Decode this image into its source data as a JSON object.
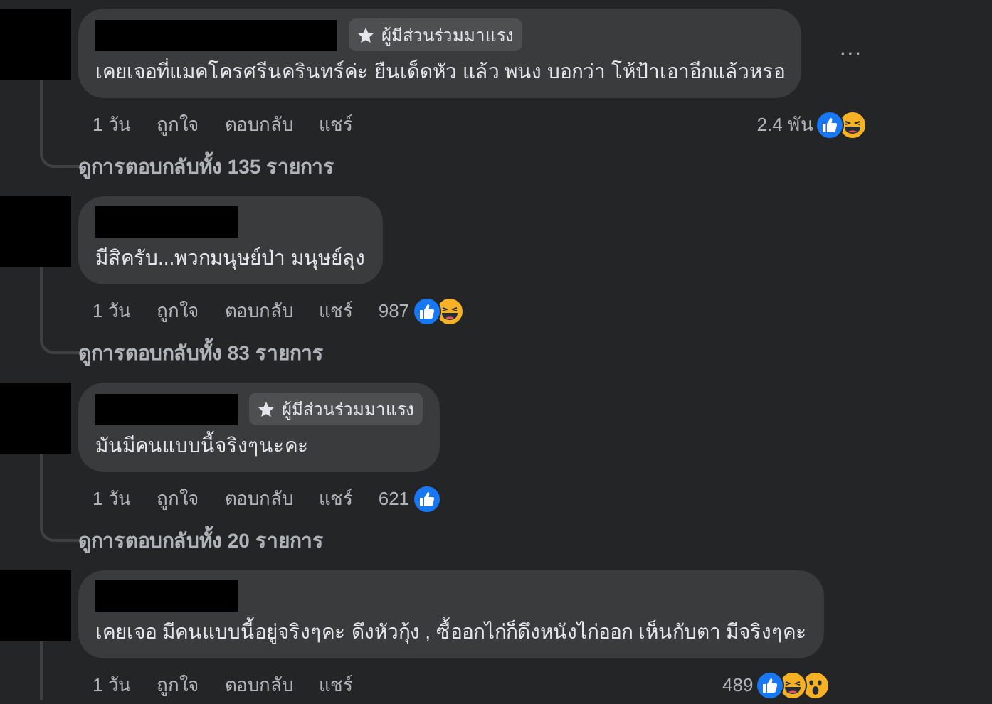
{
  "comments": [
    {
      "badge": "ผู้มีส่วนร่วมมาแรง",
      "text": "เคยเจอที่แมคโครศรีนครินทร์ค่ะ ยืนเด็ดหัว แล้ว พนง บอกว่า โห้ป้าเอาอีกแล้วหรอ",
      "more": "···",
      "time": "1 วัน",
      "actions": [
        "ถูกใจ",
        "ตอบกลับ",
        "แชร์"
      ],
      "reaction_count": "2.4 พัน",
      "reactions": [
        {
          "kind": "like"
        },
        {
          "kind": "haha"
        }
      ],
      "replies": "ดูการตอบกลับทั้ง 135 รายการ"
    },
    {
      "text": "มีสิครับ...พวกมนุษย์ป่า มนุษย์ลุง",
      "time": "1 วัน",
      "actions": [
        "ถูกใจ",
        "ตอบกลับ",
        "แชร์"
      ],
      "reaction_count": "987",
      "reactions": [
        {
          "kind": "like"
        },
        {
          "kind": "haha"
        }
      ],
      "replies": "ดูการตอบกลับทั้ง 83 รายการ"
    },
    {
      "badge": "ผู้มีส่วนร่วมมาแรง",
      "text": "มันมีคนแบบนี้จริงๆนะคะ",
      "time": "1 วัน",
      "actions": [
        "ถูกใจ",
        "ตอบกลับ",
        "แชร์"
      ],
      "reaction_count": "621",
      "reactions": [
        {
          "kind": "like"
        }
      ],
      "replies": "ดูการตอบกลับทั้ง 20 รายการ"
    },
    {
      "text": "เคยเจอ มีคนแบบนี้อยู่จริงๆคะ ดึงหัวกุ้ง , ซื้ออกไก่ก็ดึงหนังไก่ออก เห็นกับตา มีจริงๆคะ",
      "time": "1 วัน",
      "actions": [
        "ถูกใจ",
        "ตอบกลับ",
        "แชร์"
      ],
      "reaction_count": "489",
      "reactions": [
        {
          "kind": "like"
        },
        {
          "kind": "haha"
        },
        {
          "kind": "wow"
        }
      ]
    }
  ]
}
